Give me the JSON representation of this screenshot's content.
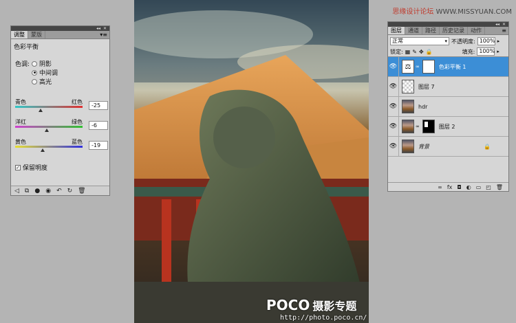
{
  "watermark": {
    "site": "思缘设计论坛",
    "url": "WWW.MISSYUAN.COM"
  },
  "photo": {
    "brand": "POCO",
    "brand_sub": "摄影专题",
    "url": "http://photo.poco.cn/"
  },
  "adjustments": {
    "tabs": [
      {
        "label": "调整",
        "active": true
      },
      {
        "label": "蒙版",
        "active": false
      }
    ],
    "title": "色彩平衡",
    "tone_label": "色调:",
    "tones": [
      {
        "label": "阴影",
        "selected": false
      },
      {
        "label": "中间调",
        "selected": true
      },
      {
        "label": "高光",
        "selected": false
      }
    ],
    "sliders": [
      {
        "left": "青色",
        "right": "红色",
        "value": "-25",
        "level": -25,
        "colors": [
          "#30c8c8",
          "#e03030"
        ]
      },
      {
        "left": "洋红",
        "right": "绿色",
        "value": "-6",
        "level": -6,
        "colors": [
          "#d040d0",
          "#30c030"
        ]
      },
      {
        "left": "黄色",
        "right": "蓝色",
        "value": "-19",
        "level": -19,
        "colors": [
          "#e8e030",
          "#3030e0"
        ]
      }
    ],
    "preserve_luminosity": {
      "label": "保留明度",
      "checked": true
    },
    "footer_icons": [
      "◁",
      "⧉",
      "●",
      "◉",
      "↶",
      "↻",
      "🗑"
    ]
  },
  "layers": {
    "tabs": [
      "图层",
      "通道",
      "路径",
      "历史记录",
      "动作"
    ],
    "active_tab": "图层",
    "blend_mode": "正常",
    "opacity_label": "不透明度:",
    "opacity": "100%",
    "lock_label": "锁定:",
    "fill_label": "填充:",
    "fill": "100%",
    "items": [
      {
        "name": "色彩平衡 1",
        "kind": "adjustment",
        "selected": true
      },
      {
        "name": "图层 7",
        "kind": "transparent",
        "selected": false
      },
      {
        "name": "hdr",
        "kind": "photo",
        "selected": false
      },
      {
        "name": "图层 2",
        "kind": "masked",
        "selected": false
      },
      {
        "name": "背景",
        "kind": "background",
        "selected": false
      }
    ],
    "footer_icons": [
      "∞",
      "fx",
      "◘",
      "◐",
      "▭",
      "◰",
      "🗑"
    ]
  }
}
